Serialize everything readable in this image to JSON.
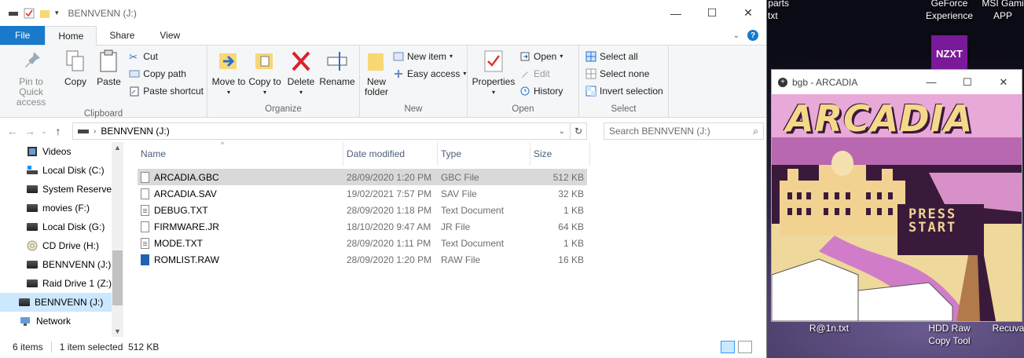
{
  "desktop": {
    "icons": [
      {
        "label": "xxx parts\nt.txt"
      },
      {
        "label": "GeForce\nExperience"
      },
      {
        "label": "MSI Gami\nAPP"
      },
      {
        "label": "NZXT"
      },
      {
        "label": "R@1n.txt"
      },
      {
        "label": "HDD Raw\nCopy Tool"
      },
      {
        "label": "Recuva"
      }
    ]
  },
  "explorer": {
    "title": "BENNVENN (J:)",
    "tabs": [
      "File",
      "Home",
      "Share",
      "View"
    ],
    "ribbon": {
      "clipboard": {
        "name": "Clipboard",
        "pin": "Pin to Quick access",
        "copy": "Copy",
        "paste": "Paste",
        "cut": "Cut",
        "copy_path": "Copy path",
        "paste_shortcut": "Paste shortcut"
      },
      "organize": {
        "name": "Organize",
        "move_to": "Move to",
        "copy_to": "Copy to",
        "delete": "Delete",
        "rename": "Rename"
      },
      "new": {
        "name": "New",
        "new_folder": "New folder",
        "new_item": "New item",
        "easy_access": "Easy access"
      },
      "open": {
        "name": "Open",
        "properties": "Properties",
        "open": "Open",
        "edit": "Edit",
        "history": "History"
      },
      "select": {
        "name": "Select",
        "select_all": "Select all",
        "select_none": "Select none",
        "invert": "Invert selection"
      }
    },
    "address": {
      "path": "BENNVENN (J:)",
      "search_placeholder": "Search BENNVENN (J:)"
    },
    "nav": [
      {
        "label": "Videos"
      },
      {
        "label": "Local Disk (C:)"
      },
      {
        "label": "System Reserved"
      },
      {
        "label": "movies (F:)"
      },
      {
        "label": "Local Disk (G:)"
      },
      {
        "label": "CD Drive (H:)"
      },
      {
        "label": "BENNVENN (J:)"
      },
      {
        "label": "Raid Drive 1 (Z:)"
      },
      {
        "label": "BENNVENN (J:)"
      },
      {
        "label": "Network"
      }
    ],
    "columns": [
      "Name",
      "Date modified",
      "Type",
      "Size"
    ],
    "files": [
      {
        "name": "ARCADIA.GBC",
        "date": "28/09/2020 1:20 PM",
        "type": "GBC File",
        "size": "512 KB"
      },
      {
        "name": "ARCADIA.SAV",
        "date": "19/02/2021 7:57 PM",
        "type": "SAV File",
        "size": "32 KB"
      },
      {
        "name": "DEBUG.TXT",
        "date": "28/09/2020 1:18 PM",
        "type": "Text Document",
        "size": "1 KB"
      },
      {
        "name": "FIRMWARE.JR",
        "date": "18/10/2020 9:47 AM",
        "type": "JR File",
        "size": "64 KB"
      },
      {
        "name": "MODE.TXT",
        "date": "28/09/2020 1:11 PM",
        "type": "Text Document",
        "size": "1 KB"
      },
      {
        "name": "ROMLIST.RAW",
        "date": "28/09/2020 1:20 PM",
        "type": "RAW File",
        "size": "16 KB"
      }
    ],
    "status": {
      "count": "6 items",
      "selected": "1 item selected  512 KB"
    }
  },
  "bgb": {
    "title": "bgb - ARCADIA",
    "logo": "ARCADIA",
    "press_start": "PRESS\nSTART"
  }
}
